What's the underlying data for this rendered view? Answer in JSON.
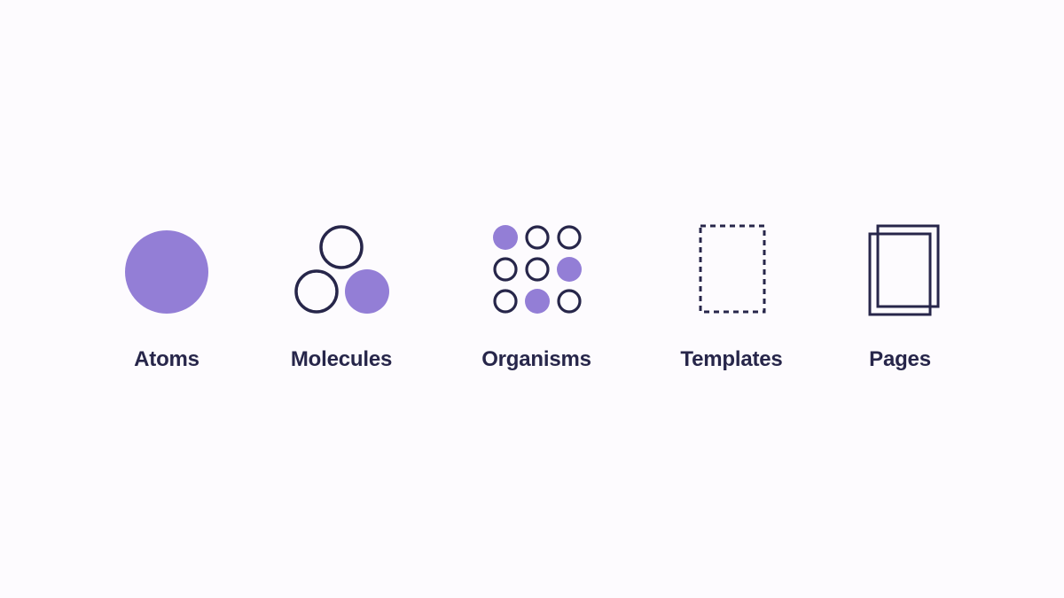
{
  "colors": {
    "background": "#fdfbfe",
    "accent": "#937ed6",
    "ink": "#27264a"
  },
  "stages": [
    {
      "id": "atoms",
      "label": "Atoms",
      "icon": "filled-circle-icon"
    },
    {
      "id": "molecules",
      "label": "Molecules",
      "icon": "three-circles-icon"
    },
    {
      "id": "organisms",
      "label": "Organisms",
      "icon": "circle-grid-icon"
    },
    {
      "id": "templates",
      "label": "Templates",
      "icon": "dashed-rectangle-icon"
    },
    {
      "id": "pages",
      "label": "Pages",
      "icon": "stacked-pages-icon"
    }
  ],
  "organisms_grid_filled": [
    [
      true,
      false,
      false
    ],
    [
      false,
      false,
      true
    ],
    [
      false,
      true,
      false
    ]
  ]
}
